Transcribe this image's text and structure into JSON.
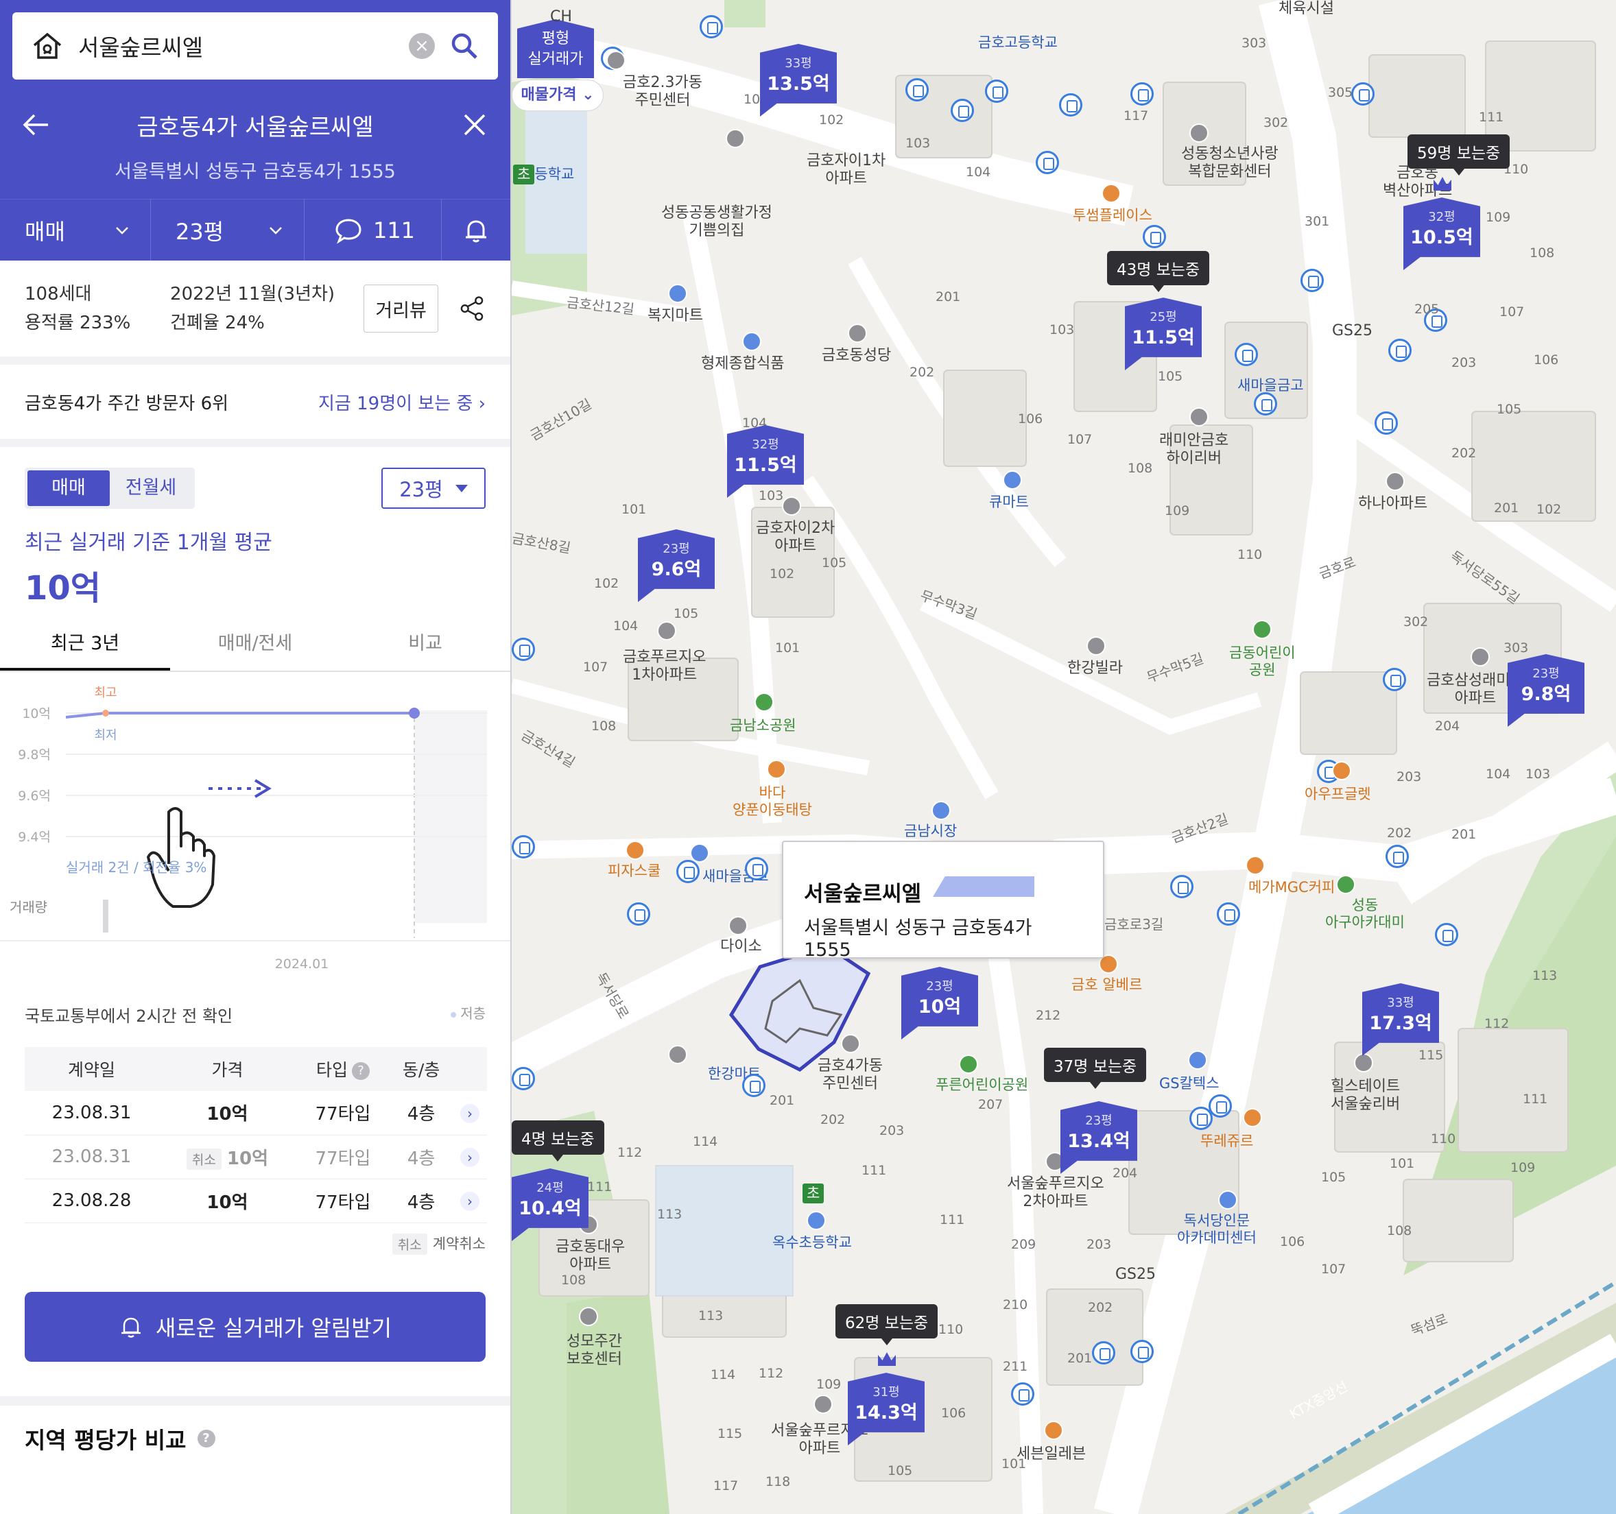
{
  "search": {
    "query": "서울숲르씨엘"
  },
  "complex": {
    "title": "금호동4가 서울숲르씨엘",
    "address": "서울특별시 성동구 금호동4가 1555"
  },
  "tabs": {
    "deal_type": "매매",
    "pyeong": "23평",
    "comments": "111"
  },
  "info": {
    "households": "108세대",
    "far": "용적률 233%",
    "built": "2022년 11월(3년차)",
    "bcr": "건폐율 24%",
    "street_view": "거리뷰"
  },
  "visitors": {
    "rank": "금호동4가 주간 방문자 6위",
    "now": "지금 19명이 보는 중"
  },
  "trade": {
    "seg_sale": "매매",
    "seg_rent": "전월세",
    "pyeong_select": "23평",
    "avg_label": "최근 실거래 기준 1개월 평균",
    "avg_value": "10억"
  },
  "chart_tabs": [
    "최근 3년",
    "매매/전세",
    "비교"
  ],
  "chart_data": {
    "type": "line",
    "y_ticks": [
      "10억",
      "9.8억",
      "9.6억",
      "9.4억"
    ],
    "ylim": [
      9.4,
      10.0
    ],
    "series": [
      {
        "values": [
          9.98,
          10.0,
          10.0
        ]
      }
    ],
    "annotations": {
      "high": "최고",
      "low": "최저"
    },
    "stats": "실거래 2건 / 회전율 3%",
    "volume_label": "거래량",
    "x_label": "2024.01"
  },
  "confirm": {
    "text": "국토교통부에서 2시간 전 확인",
    "legend": "저층"
  },
  "table": {
    "headers": [
      "계약일",
      "가격",
      "타입",
      "동/층"
    ],
    "rows": [
      {
        "date": "23.08.31",
        "price": "10억",
        "type": "77타입",
        "floor": "4층",
        "cancelled": ""
      },
      {
        "date": "23.08.31",
        "price": "10억",
        "type": "77타입",
        "floor": "4층",
        "cancelled": "취소"
      },
      {
        "date": "23.08.28",
        "price": "10억",
        "type": "77타입",
        "floor": "4층",
        "cancelled": ""
      }
    ],
    "cancel_badge": "취소",
    "cancel_legend": "계약취소"
  },
  "alert_button": "새로운 실거래가 알림받기",
  "region_title": "지역 평당가 비교",
  "map": {
    "mode_top": "평형\n실거래가",
    "mode_select": "매물가격",
    "callout": {
      "name": "서울숲르씨엘",
      "address": "서울특별시 성동구 금호동4가 1555"
    },
    "pins": [
      {
        "py": "33평",
        "pr": "13.5억"
      },
      {
        "py": "32평",
        "pr": "10.5억"
      },
      {
        "py": "25평",
        "pr": "11.5억"
      },
      {
        "py": "32평",
        "pr": "11.5억"
      },
      {
        "py": "23평",
        "pr": "9.6억"
      },
      {
        "py": "23평",
        "pr": "9.8억"
      },
      {
        "py": "23평",
        "pr": "10억"
      },
      {
        "py": "33평",
        "pr": "17.3억"
      },
      {
        "py": "23평",
        "pr": "13.4억"
      },
      {
        "py": "24평",
        "pr": "10.4억"
      },
      {
        "py": "31평",
        "pr": "14.3억"
      }
    ],
    "viewers": [
      "59명 보는중",
      "43명 보는중",
      "37명 보는중",
      "4명 보는중",
      "62명 보는중"
    ],
    "labels": {
      "sports": "체육시설",
      "geumho_high": "금호고등학교",
      "center23": "금호2.3가동\n주민센터",
      "geumho_apt1": "금호자이1차\n아파트",
      "welfare": "성동공동생활가정\n기쁨의집",
      "bokji_mart": "복지마트",
      "hyungje": "형제종합식품",
      "geumho_church": "금호동성당",
      "toosome": "투썸플레이스",
      "culture": "성동청소년사랑\n복합문화센터",
      "byeoksan": "금호동\n벽산아파트",
      "gs25_a": "GS25",
      "saemaeul_a": "새마을금고",
      "raemian": "래미안금호\n하이리버",
      "qmart": "큐마트",
      "hana": "하나아파트",
      "geumho_apt2": "금호자이2차\n아파트",
      "prugio1": "금호푸르지오\n1차아파트",
      "hangang_villa": "한강빌라",
      "child_park": "금동어린이\n공원",
      "samsung": "금호삼성래미안\n아파트",
      "geumnam_park": "금남소공원",
      "bada": "바다\n양푼이동태탕",
      "pizza": "피자스쿨",
      "saemaeul_b": "새마을금고",
      "geumnam_market": "금남시장",
      "ouf": "아우프글렛",
      "mega": "메가MGC커피",
      "daiso": "다이소",
      "seongdong_apt": "성동\n아구아카대미",
      "almbe": "금호 알베르",
      "hillstate": "힐스테이트\n서울숲리버",
      "center4": "금호4가동\n주민센터",
      "hangang_mart": "한강마트",
      "prun_park": "푸른어린이공원",
      "gs_caltex": "GS칼텍스",
      "tous": "뚜레쥬르",
      "prugio2": "서울숲푸르지오\n2차아파트",
      "daewoo": "금호동대우\n아파트",
      "oksu_elem": "옥수초등학교",
      "doksodang": "독서당인문\n아카데미센터",
      "gs25_b": "GS25",
      "health": "성모주간\n보호센터",
      "prugio_seoul": "서울숲푸르지오\n아파트",
      "seven": "세븐일레븐",
      "elem_a": "초",
      "elem_b": "초",
      "ddukseom": "뚝섬로",
      "ktx": "KTX중앙선",
      "dokseo55": "독서당로55길",
      "moosu3": "무수막3길",
      "moosu5": "무수막5길",
      "geumho_ro": "금호로",
      "geumho_san2": "금호산2길",
      "geumho_san4": "금호산4길",
      "geumho_san8": "금호산8길",
      "geumho_san10": "금호산10길",
      "geumho_san12": "금호산12길",
      "geumho_ro3": "금호로3길",
      "dokseodang": "독서당로",
      "school_a": "초등학교",
      "ch": "CH"
    }
  }
}
